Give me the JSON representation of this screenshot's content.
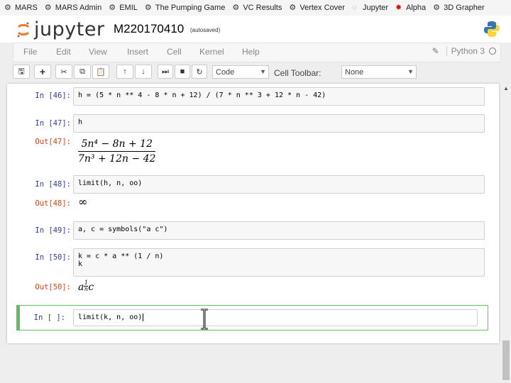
{
  "bookmarks": [
    {
      "label": "MARS",
      "icon": "mars-icon"
    },
    {
      "label": "MARS Admin",
      "icon": "mars-icon"
    },
    {
      "label": "EMIL",
      "icon": "mars-icon"
    },
    {
      "label": "The Pumping Game",
      "icon": "mars-icon"
    },
    {
      "label": "VC Results",
      "icon": "mars-icon"
    },
    {
      "label": "Vertex Cover",
      "icon": "mars-icon"
    },
    {
      "label": "Jupyter",
      "icon": "jupyter-icon"
    },
    {
      "label": "Alpha",
      "icon": "wolfram-icon"
    },
    {
      "label": "3D Grapher",
      "icon": "mars-icon"
    }
  ],
  "header": {
    "logo_text": "jupyter",
    "notebook_name": "M220170410",
    "autosave": "(autosaved)"
  },
  "menu": {
    "items": [
      "File",
      "Edit",
      "View",
      "Insert",
      "Cell",
      "Kernel",
      "Help"
    ],
    "kernel_name": "Python 3"
  },
  "toolbar": {
    "cell_type": "Code",
    "cell_toolbar_label": "Cell Toolbar:",
    "cell_toolbar_value": "None"
  },
  "cells": [
    {
      "prompt": "In [46]:",
      "code": "h = (5 * n ** 4 - 8 * n + 12) / (7 * n ** 3 + 12 * n - 42)"
    },
    {
      "prompt": "In [47]:",
      "code": "h"
    },
    {
      "prompt": "Out[47]:",
      "num": "5n⁴ − 8n + 12",
      "den": "7n³ + 12n − 42"
    },
    {
      "prompt": "In [48]:",
      "code": "limit(h, n, oo)"
    },
    {
      "prompt": "Out[48]:",
      "result": "∞"
    },
    {
      "prompt": "In [49]:",
      "code": "a, c = symbols(\"a c\")"
    },
    {
      "prompt": "In [50]:",
      "code": "k = c * a ** (1 / n)",
      "code2": "k"
    },
    {
      "prompt": "Out[50]:",
      "base": "a",
      "exp_num": "1",
      "exp_den": "n",
      "tail": "c"
    },
    {
      "prompt": "In [ ]:",
      "code": "limit(k, n, oo)"
    }
  ]
}
